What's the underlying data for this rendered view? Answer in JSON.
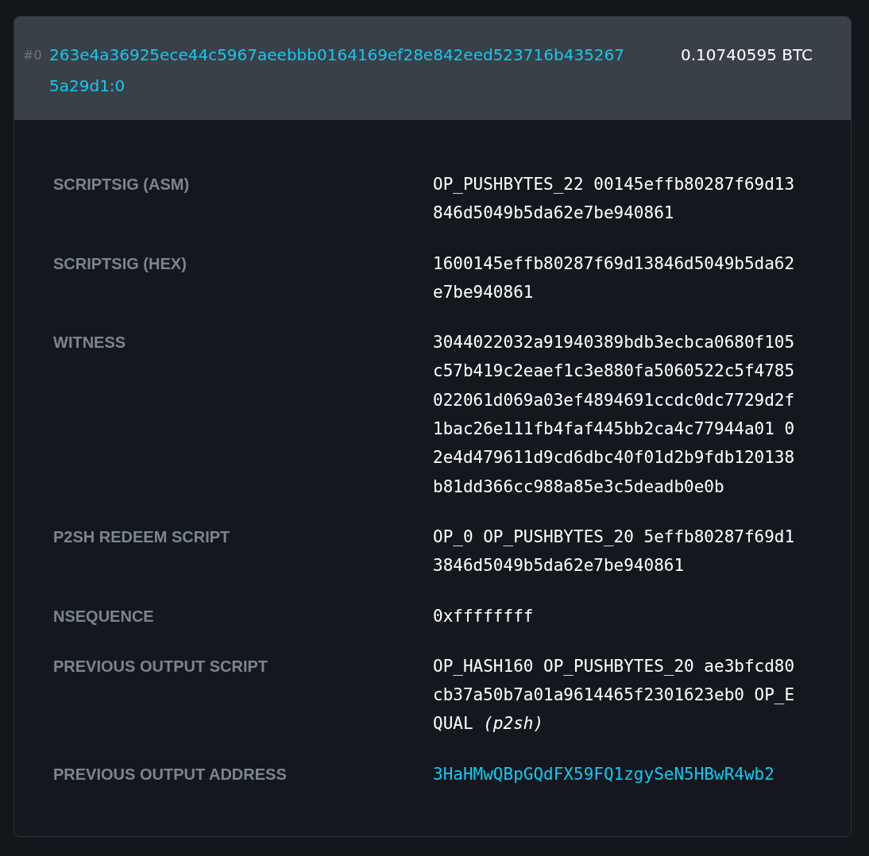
{
  "input": {
    "index": "#0",
    "outpoint": "263e4a36925ece44c5967aeebbb0164169ef28e842eed523716b4352675a29d1:0",
    "amount": "0.10740595 BTC"
  },
  "details": [
    {
      "label": "SCRIPTSIG (ASM)",
      "value": "OP_PUSHBYTES_22 00145effb80287f69d13846d5049b5da62e7be940861",
      "kind": "text"
    },
    {
      "label": "SCRIPTSIG (HEX)",
      "value": "1600145effb80287f69d13846d5049b5da62e7be940861",
      "kind": "text"
    },
    {
      "label": "WITNESS",
      "value": "3044022032a91940389bdb3ecbca0680f105c57b419c2eaef1c3e880fa5060522c5f4785022061d069a03ef4894691ccdc0dc7729d2f1bac26e111fb4faf445bb2ca4c77944a01 02e4d479611d9cd6dbc40f01d2b9fdb120138b81dd366cc988a85e3c5deadb0e0b",
      "kind": "text"
    },
    {
      "label": "P2SH REDEEM SCRIPT",
      "value": "OP_0 OP_PUSHBYTES_20 5effb80287f69d13846d5049b5da62e7be940861",
      "kind": "text"
    },
    {
      "label": "NSEQUENCE",
      "value": "0xffffffff",
      "kind": "text"
    },
    {
      "label": "PREVIOUS OUTPUT SCRIPT",
      "value": "OP_HASH160 OP_PUSHBYTES_20 ae3bfcd80cb37a50b7a01a9614465f2301623eb0 OP_EQUAL *(p2sh)*",
      "kind": "text"
    },
    {
      "label": "PREVIOUS OUTPUT ADDRESS",
      "value": "3HaHMwQBpGQdFX59FQ1zgySeN5HBwR4wb2",
      "kind": "link"
    }
  ]
}
